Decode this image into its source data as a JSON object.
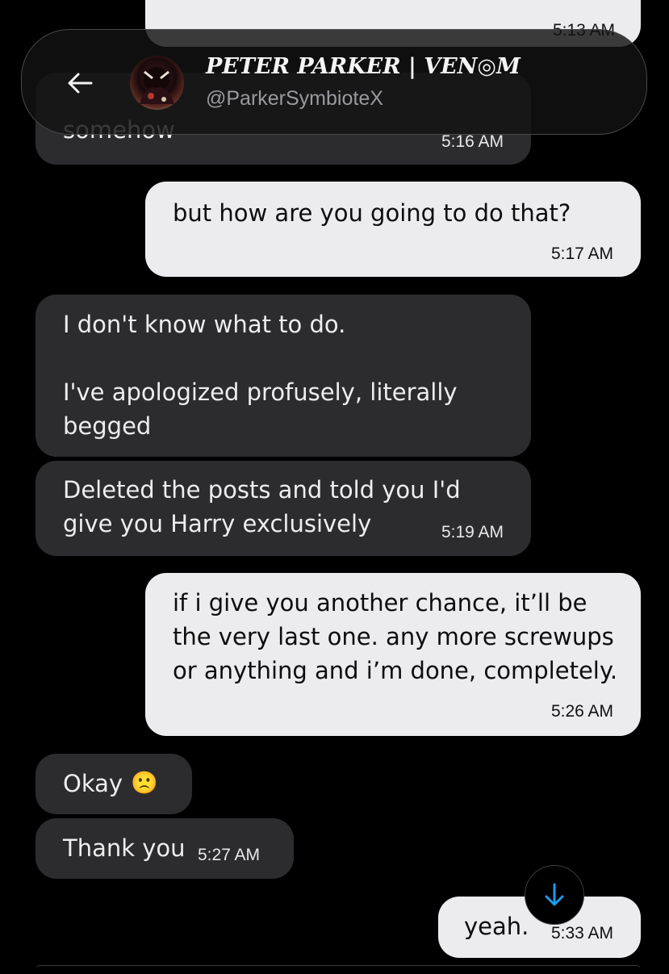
{
  "header": {
    "back_icon": "arrow-left-icon",
    "name": "PETER PARKER | VEN◎M",
    "handle": "@ParkerSymbioteX"
  },
  "messages": [
    {
      "side": "out",
      "text": "",
      "time": "5:13 AM",
      "partial": true
    },
    {
      "side": "in",
      "text": "somehow",
      "time": "5:16 AM",
      "partial": true
    },
    {
      "side": "out",
      "text": "but how are you going to do that?",
      "time": "5:17 AM"
    },
    {
      "side": "in",
      "text": "I don't know what to do.\n\nI've apologized profusely, literally\nbegged"
    },
    {
      "side": "in",
      "text": "Deleted the posts and told you I'd\ngive you Harry exclusively",
      "time": "5:19 AM"
    },
    {
      "side": "out",
      "text": "if i give you another chance, it’ll be\nthe very last one. any more screwups\nor anything and i’m done, completely.",
      "time": "5:26 AM"
    },
    {
      "side": "in",
      "text": "Okay",
      "emoji": "🙁"
    },
    {
      "side": "in",
      "text": "Thank you",
      "time": "5:27 AM"
    },
    {
      "side": "out",
      "text": "yeah.",
      "time": "5:33 AM"
    }
  ],
  "scroll_button_icon": "arrow-down-icon",
  "colors": {
    "background": "#000000",
    "incoming_bubble": "#2c2c2e",
    "outgoing_bubble": "#ececee",
    "accent": "#1d9bf0"
  }
}
